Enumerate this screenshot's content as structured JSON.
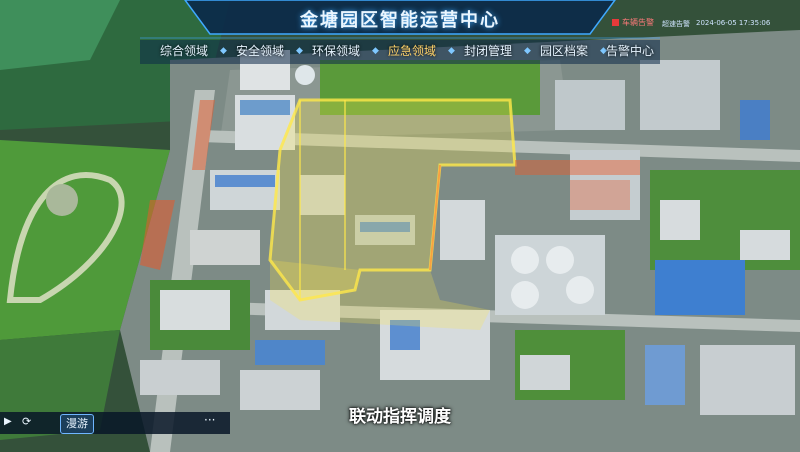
{
  "header": {
    "title": "金塘园区智能运营中心",
    "alarm_label": "车辆告警",
    "sub_label": "超速告警",
    "datetime": "2024-06-05 17:35:06"
  },
  "nav": {
    "tabs": [
      {
        "label": "综合领域",
        "active": false
      },
      {
        "label": "安全领域",
        "active": false
      },
      {
        "label": "环保领域",
        "active": false
      },
      {
        "label": "应急领域",
        "active": true
      },
      {
        "label": "封闭管理",
        "active": false
      },
      {
        "label": "园区档案",
        "active": false
      },
      {
        "label": "告警中心",
        "active": false
      }
    ]
  },
  "controls": {
    "roam_label": "漫游",
    "more_label": "···"
  },
  "caption": "联动指挥调度",
  "colors": {
    "accent": "#3fa9ff",
    "active_tab": "#ffd36b",
    "highlight": "#ffe94a",
    "alarm": "#e63a3a"
  }
}
